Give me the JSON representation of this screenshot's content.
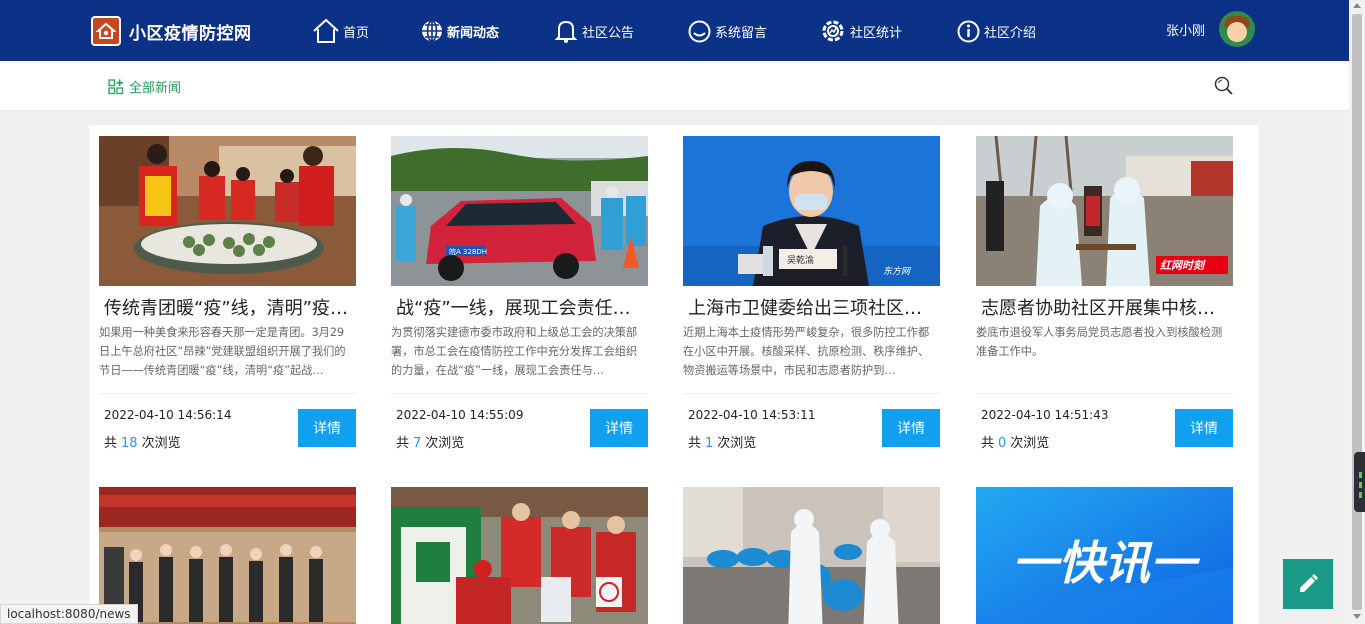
{
  "brand": {
    "title": "小区疫情防控网"
  },
  "nav": [
    {
      "label": "首页",
      "icon": "home-icon"
    },
    {
      "label": "新闻动态",
      "icon": "globe-icon"
    },
    {
      "label": "社区公告",
      "icon": "bell-icon"
    },
    {
      "label": "系统留言",
      "icon": "message-icon"
    },
    {
      "label": "社区统计",
      "icon": "chart-gear-icon"
    },
    {
      "label": "社区介绍",
      "icon": "info-icon"
    }
  ],
  "user": {
    "name": "张小刚"
  },
  "subbar": {
    "all_news": "全部新闻"
  },
  "cards": [
    {
      "title": "传统青团暖“疫”线，清明”疫”起战…",
      "desc": "如果用一种美食来形容春天那一定是青团。3月29日上午总府社区“昂辣”党建联盟组织开展了我们的节日——传统青团暖“疫”线，清明“疫”起战…",
      "date": "2022-04-10 14:56:14",
      "views_prefix": "共",
      "views": "18",
      "views_suffix": "次浏览",
      "button": "详情"
    },
    {
      "title": "战“疫”一线，展现工会责任与担当",
      "desc": "为贯彻落实建德市委市政府和上级总工会的决策部署，市总工会在疫情防控工作中充分发挥工会组织的力量，在战“疫”一线，展现工会责任与…",
      "date": "2022-04-10 14:55:09",
      "views_prefix": "共",
      "views": "7",
      "views_suffix": "次浏览",
      "button": "详情"
    },
    {
      "title": "上海市卫健委给出三项社区防控措施",
      "desc": "近期上海本土疫情形势严峻复杂，很多防控工作都在小区中开展。核酸采样、抗原检测、秩序维护、物资搬运等场景中，市民和志愿者防护到…",
      "date": "2022-04-10 14:53:11",
      "views_prefix": "共",
      "views": "1",
      "views_suffix": "次浏览",
      "button": "详情"
    },
    {
      "title": "志愿者协助社区开展集中核酸检测",
      "desc": "娄底市退役军人事务局党员志愿者投入到核酸检测准备工作中。",
      "date": "2022-04-10 14:51:43",
      "views_prefix": "共",
      "views": "0",
      "views_suffix": "次浏览",
      "button": "详情"
    }
  ],
  "photo_text": {
    "card3_badge": "东方网",
    "card4_badge": "红网时刻",
    "card3_nameplate": "吴乾渝",
    "banner": "一快讯一",
    "plate": "皖A 328DH"
  },
  "status": {
    "url": "localhost:8080/news"
  },
  "colors": {
    "header": "#0c3288",
    "accent": "#21a35b",
    "button": "#11a0f0",
    "fab": "#1a9a86",
    "views": "#2196f3"
  }
}
